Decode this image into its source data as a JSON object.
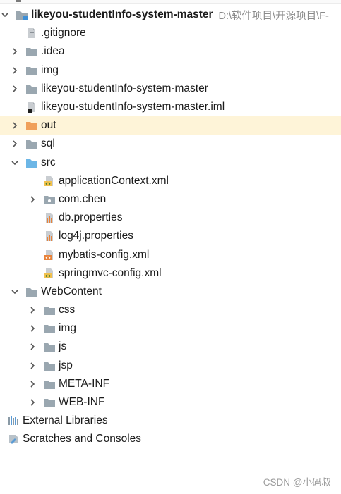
{
  "root": {
    "label": "likeyou-studentInfo-system-master",
    "path": "D:\\软件项目\\开源项目\\F-"
  },
  "items": {
    "gitignore": ".gitignore",
    "idea": ".idea",
    "img": "img",
    "inner_project": "likeyou-studentInfo-system-master",
    "iml": "likeyou-studentInfo-system-master.iml",
    "out": "out",
    "sql": "sql",
    "src": "src",
    "applicationContext": "applicationContext.xml",
    "com_chen": "com.chen",
    "db_properties": "db.properties",
    "log4j_properties": "log4j.properties",
    "mybatis_config": "mybatis-config.xml",
    "springmvc_config": "springmvc-config.xml",
    "webcontent": "WebContent",
    "css": "css",
    "web_img": "img",
    "js": "js",
    "jsp": "jsp",
    "meta_inf": "META-INF",
    "web_inf": "WEB-INF",
    "external_libraries": "External Libraries",
    "scratches": "Scratches and Consoles"
  },
  "watermark": "CSDN @小码叔",
  "colors": {
    "folder": "#9aa7b0",
    "folder_out": "#f0a05a",
    "folder_src": "#6cb6e6",
    "selected_row": "#fef4d8",
    "xml_orange": "#e8823a",
    "xml_green": "#5aa24a"
  }
}
